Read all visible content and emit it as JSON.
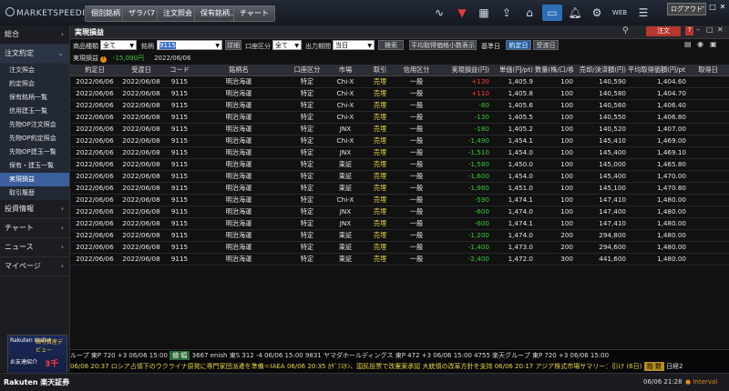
{
  "app": {
    "logo_text": "MARKETSPEEDⅡ",
    "login_label": "ログアウト",
    "top_tabs": [
      "個別銘柄",
      "ザラバ7",
      "注文照会",
      "保有銘柄...",
      "チャート"
    ],
    "web_label": "WEB"
  },
  "sidebar": {
    "items": [
      {
        "label": "総合",
        "chev": "›"
      },
      {
        "label": "注文約定",
        "chev": "⌄"
      },
      {
        "label": "投資情報",
        "chev": "›"
      },
      {
        "label": "チャート",
        "chev": "›"
      },
      {
        "label": "ニュース",
        "chev": "›"
      },
      {
        "label": "マイページ",
        "chev": "›"
      }
    ],
    "subitems": [
      "注文照会",
      "約定照会",
      "保有銘柄一覧",
      "信用建玉一覧",
      "先物OP注文照会",
      "先物OP約定照会",
      "先物OP建玉一覧",
      "保有・建玉一覧",
      "実現損益",
      "取引履歴"
    ],
    "promo": {
      "brand": "Rakuten Wallet",
      "title": "暗号資産デビュー",
      "sub": "お友達紹介",
      "amount": "3千"
    }
  },
  "panel": {
    "title": "実現損益",
    "order_button": "注文",
    "filters": {
      "product_label": "商品種類",
      "product_value": "全て",
      "symbol_label": "銘柄",
      "symbol_value": "9115",
      "detail_button": "詳細",
      "account_label": "口座区分",
      "account_value": "全て",
      "period_label": "出力期間",
      "period_value": "当日",
      "search_button": "検索",
      "decimal_button": "平均取得価格小数表示",
      "base_label": "基準日",
      "contract_button": "約定日",
      "delivery_button": "受渡日"
    },
    "summary": {
      "label": "実現損益",
      "value": "-15,090円",
      "date": "2022/06/06"
    }
  },
  "table": {
    "headers": [
      "約定日",
      "受渡日",
      "コード",
      "銘柄名",
      "口座区分",
      "市場",
      "取引",
      "信用区分",
      "実現損益(円)",
      "単価(円/pt)",
      "数量(株/口/枚)",
      "売却/決済額(円)",
      "平均取得価額(円/pt)",
      "取得日"
    ],
    "rows": [
      [
        "2022/06/06",
        "2022/06/08",
        "9115",
        "明治海運",
        "特定",
        "Chi-X",
        "売埋",
        "一般",
        "+130",
        "1,405.9",
        "100",
        "140,590",
        "1,404.60"
      ],
      [
        "2022/06/06",
        "2022/06/08",
        "9115",
        "明治海運",
        "特定",
        "Chi-X",
        "売埋",
        "一般",
        "+110",
        "1,405.8",
        "100",
        "140,580",
        "1,404.70"
      ],
      [
        "2022/06/06",
        "2022/06/08",
        "9115",
        "明治海運",
        "特定",
        "Chi-X",
        "売埋",
        "一般",
        "-80",
        "1,405.6",
        "100",
        "140,560",
        "1,406.40"
      ],
      [
        "2022/06/06",
        "2022/06/08",
        "9115",
        "明治海運",
        "特定",
        "Chi-X",
        "売埋",
        "一般",
        "-130",
        "1,405.5",
        "100",
        "140,550",
        "1,406.80"
      ],
      [
        "2022/06/06",
        "2022/06/08",
        "9115",
        "明治海運",
        "特定",
        "JNX",
        "売埋",
        "一般",
        "-180",
        "1,405.2",
        "100",
        "140,520",
        "1,407.00"
      ],
      [
        "2022/06/06",
        "2022/06/08",
        "9115",
        "明治海運",
        "特定",
        "Chi-X",
        "売埋",
        "一般",
        "-1,490",
        "1,454.1",
        "100",
        "145,410",
        "1,469.00"
      ],
      [
        "2022/06/06",
        "2022/06/08",
        "9115",
        "明治海運",
        "特定",
        "JNX",
        "売埋",
        "一般",
        "-1,510",
        "1,454.0",
        "100",
        "145,400",
        "1,469.10"
      ],
      [
        "2022/06/06",
        "2022/06/08",
        "9115",
        "明治海運",
        "特定",
        "東証",
        "売埋",
        "一般",
        "-1,580",
        "1,450.0",
        "100",
        "145,000",
        "1,465.80"
      ],
      [
        "2022/06/06",
        "2022/06/08",
        "9115",
        "明治海運",
        "特定",
        "東証",
        "売埋",
        "一般",
        "-1,600",
        "1,454.0",
        "100",
        "145,400",
        "1,470.00"
      ],
      [
        "2022/06/06",
        "2022/06/08",
        "9115",
        "明治海運",
        "特定",
        "東証",
        "売埋",
        "一般",
        "-1,980",
        "1,451.0",
        "100",
        "145,100",
        "1,470.80"
      ],
      [
        "2022/06/06",
        "2022/06/08",
        "9115",
        "明治海運",
        "特定",
        "Chi-X",
        "売埋",
        "一般",
        "-590",
        "1,474.1",
        "100",
        "147,410",
        "1,480.00"
      ],
      [
        "2022/06/06",
        "2022/06/08",
        "9115",
        "明治海運",
        "特定",
        "JNX",
        "売埋",
        "一般",
        "-600",
        "1,474.0",
        "100",
        "147,400",
        "1,480.00"
      ],
      [
        "2022/06/06",
        "2022/06/08",
        "9115",
        "明治海運",
        "特定",
        "JNX",
        "売埋",
        "一般",
        "-600",
        "1,474.1",
        "100",
        "147,410",
        "1,480.00"
      ],
      [
        "2022/06/06",
        "2022/06/08",
        "9115",
        "明治海運",
        "特定",
        "東証",
        "売埋",
        "一般",
        "-1,200",
        "1,474.0",
        "200",
        "294,800",
        "1,480.00"
      ],
      [
        "2022/06/06",
        "2022/06/08",
        "9115",
        "明治海運",
        "特定",
        "東証",
        "売埋",
        "一般",
        "-1,400",
        "1,473.0",
        "200",
        "294,600",
        "1,480.00"
      ],
      [
        "2022/06/06",
        "2022/06/08",
        "9115",
        "明治海運",
        "特定",
        "東証",
        "売埋",
        "一般",
        "-2,400",
        "1,472.0",
        "300",
        "441,600",
        "1,480.00"
      ]
    ]
  },
  "ticker": {
    "line1": "ループ 東P 720 +3 06/06 15:00",
    "tag1": "値 幅",
    "line1b": "3667 enish 東S 312 -4 06/06 15:00   9831 ヤマダホールディングス 東P 472 +3 06/06 15:00   4755 楽天グループ 東P 720 +3 06/06 15:00",
    "line2": "06/06 20:37 ロシア占領下のウクライナ原発に専門家団派遣を準備＝IAEA   06/06 20:35 ｶｻﾞﾌｽﾀﾝ、国民投票で改憲案承認 大統領の改革方針を支持   06/06 20:17 アジア株式市場サマリー：引け (6日)",
    "tag2": "指 数",
    "line2b": "日経2"
  },
  "status": {
    "brand": "Rakuten 楽天証券",
    "time": "06/06 21:28",
    "interval": "● Interval"
  }
}
